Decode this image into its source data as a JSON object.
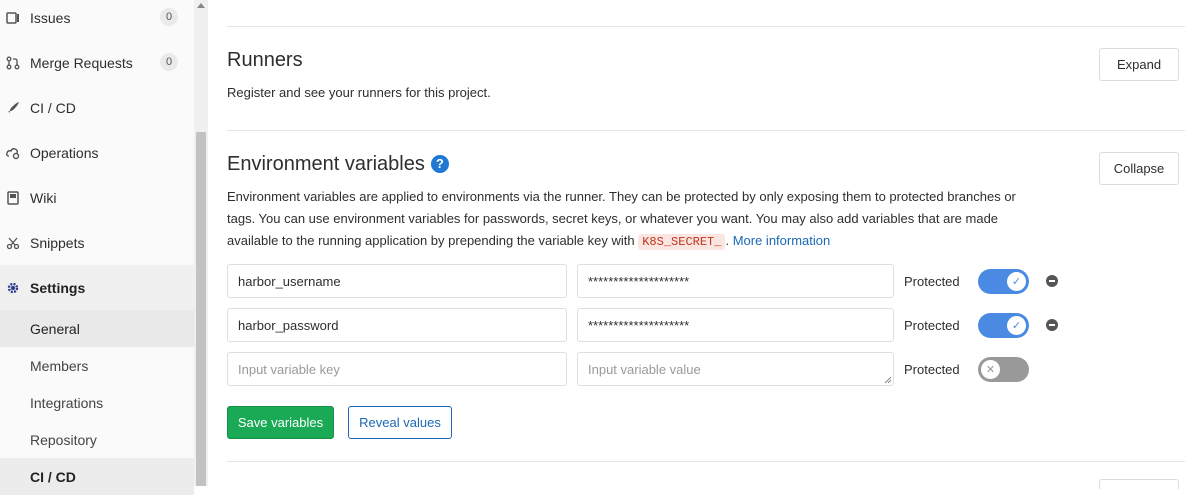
{
  "sidebar": {
    "items": [
      {
        "label": "Issues",
        "count": "0",
        "icon": "issues-icon"
      },
      {
        "label": "Merge Requests",
        "count": "0",
        "icon": "merge-request-icon"
      },
      {
        "label": "CI / CD",
        "icon": "rocket-icon"
      },
      {
        "label": "Operations",
        "icon": "cloud-gear-icon"
      },
      {
        "label": "Wiki",
        "icon": "book-icon"
      },
      {
        "label": "Snippets",
        "icon": "scissors-icon"
      },
      {
        "label": "Settings",
        "icon": "gear-icon"
      }
    ],
    "settings_sub": [
      "General",
      "Members",
      "Integrations",
      "Repository",
      "CI / CD"
    ]
  },
  "runners": {
    "title": "Runners",
    "description": "Register and see your runners for this project.",
    "expand_label": "Expand"
  },
  "env": {
    "title": "Environment variables",
    "help": "?",
    "collapse_label": "Collapse",
    "desc_line1": "Environment variables are applied to environments via the runner. They can be protected by only exposing them to protected branches or",
    "desc_line2": "tags. You can use environment variables for passwords, secret keys, or whatever you want. You may also add variables that are made",
    "desc_line3": "available to the running application by prepending the variable key with",
    "code": "K8S_SECRET_",
    "dot": ".",
    "more_link": "More information",
    "rows": [
      {
        "key": "harbor_username",
        "value": "********************",
        "protected_label": "Protected",
        "protected": true
      },
      {
        "key": "harbor_password",
        "value": "********************",
        "protected_label": "Protected",
        "protected": true
      }
    ],
    "new_row": {
      "key_placeholder": "Input variable key",
      "value_placeholder": "Input variable value",
      "protected_label": "Protected",
      "protected": false
    },
    "save_label": "Save variables",
    "reveal_label": "Reveal values"
  },
  "colors": {
    "accent": "#1b69b6",
    "toggle_on": "#4a8ae3",
    "save": "#1aaa55"
  }
}
